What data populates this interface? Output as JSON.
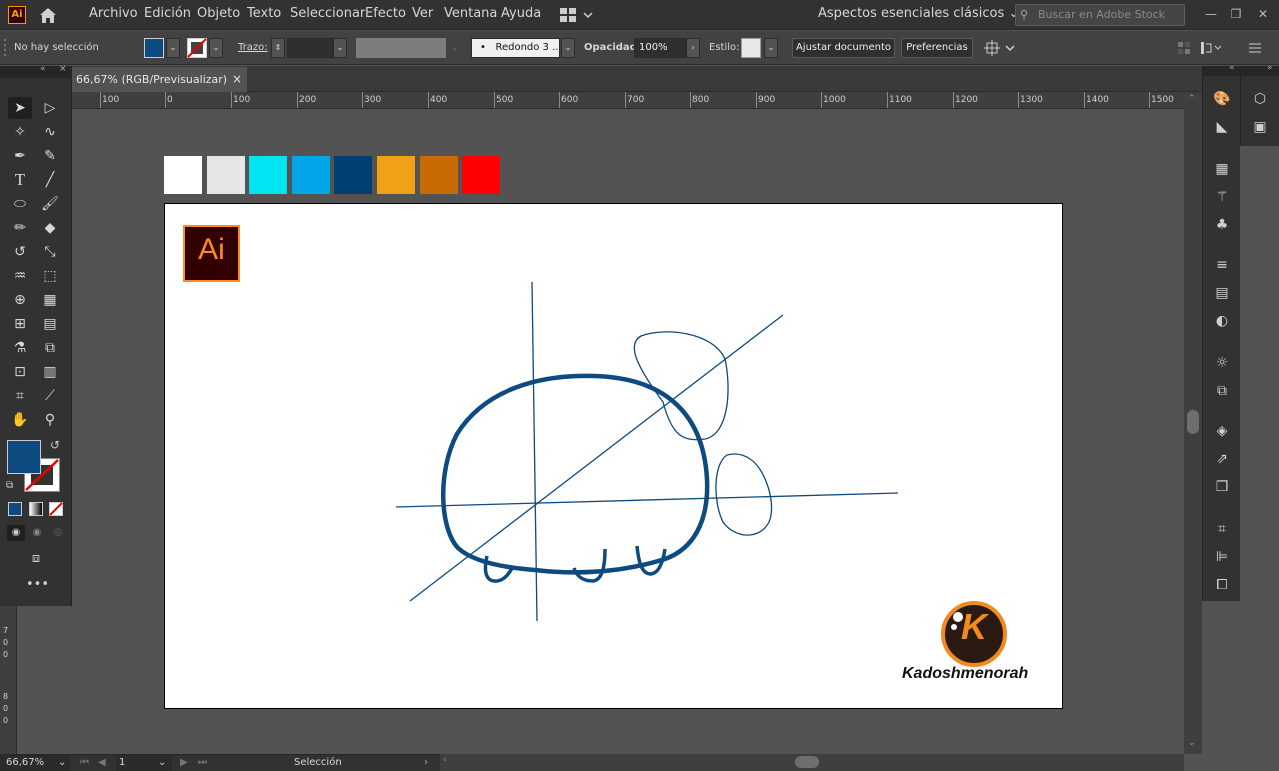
{
  "menubar": {
    "app_icon_label": "Ai",
    "items": [
      "Archivo",
      "Edición",
      "Objeto",
      "Texto",
      "Seleccionar",
      "Efecto",
      "Ver",
      "Ventana",
      "Ayuda"
    ],
    "workspace": "Aspectos esenciales clásicos",
    "search_placeholder": "Buscar en Adobe Stock"
  },
  "controlbar": {
    "selection_status": "No hay selección",
    "fill_color": "#0d4a80",
    "stroke_label": "Trazo:",
    "brush_label": "Redondo 3 ...",
    "brush_bullet": "•",
    "opacity_label": "Opacidad:",
    "opacity_value": "100%",
    "style_label": "Estilo:",
    "adjust_button": "Ajustar documento",
    "preferences_button": "Preferencias"
  },
  "document": {
    "tab_title": "66,67% (RGB/Previsualizar)",
    "tab_close": "×"
  },
  "ruler": {
    "labels": [
      "100",
      "0",
      "100",
      "200",
      "300",
      "400",
      "500",
      "600",
      "700",
      "800",
      "900",
      "1000",
      "1100",
      "1200",
      "1300",
      "1400",
      "1500"
    ]
  },
  "vruler_labels": [
    "7",
    "0",
    "0",
    "8",
    "0",
    "0"
  ],
  "color_swatches": [
    "#ffffff",
    "#e6e6e6",
    "#00e5f2",
    "#00a6e8",
    "#003f73",
    "#f0a118",
    "#c96b05",
    "#ff0000"
  ],
  "artboard": {
    "ai_logo_text": "Ai",
    "brand_name": "Kadoshmenorah",
    "brand_letter": "K",
    "drawing_color": "#0d4a80",
    "accent_color": "#f28a1e"
  },
  "toolbar": {
    "fill_color": "#0d4a80"
  },
  "statusbar": {
    "zoom": "66,67%",
    "page": "1",
    "tool": "Selección"
  }
}
